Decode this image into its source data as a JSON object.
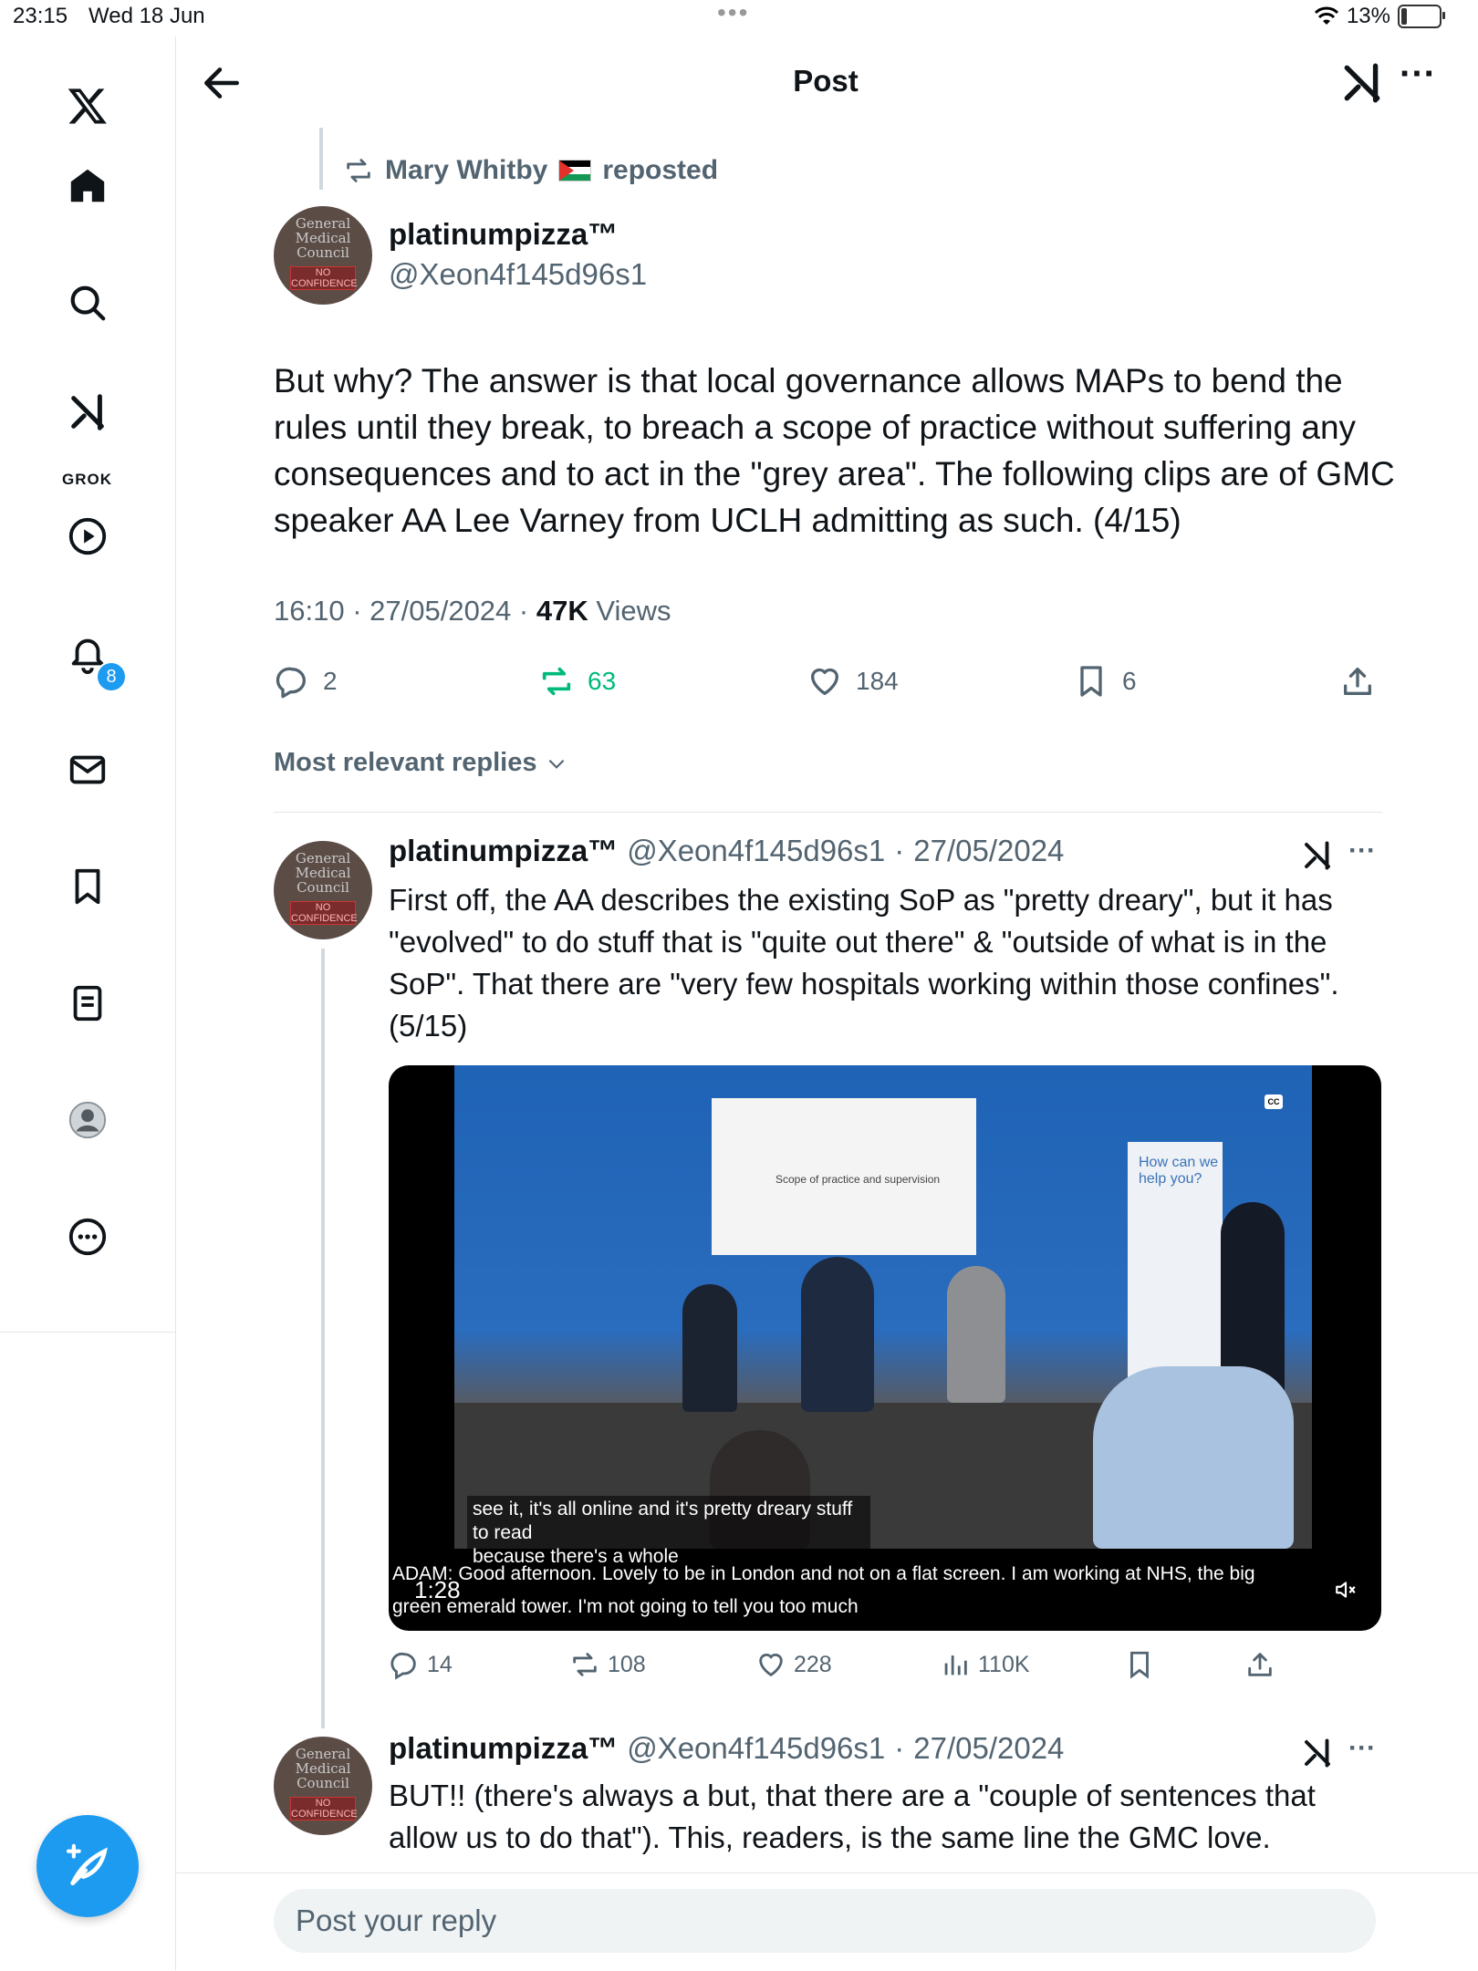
{
  "status_bar": {
    "time": "23:15",
    "date": "Wed 18 Jun",
    "battery": "13%"
  },
  "header": {
    "title": "Post"
  },
  "sidebar": {
    "grok_label": "GROK",
    "notifications_badge": "8"
  },
  "main_post": {
    "repost_label": "Mary Whitby",
    "repost_suffix": "reposted",
    "author_name": "platinumpizza™",
    "author_handle": "@Xeon4f145d96s1",
    "avatar_text": [
      "General",
      "Medical",
      "Council"
    ],
    "avatar_stamp": "NO CONFIDENCE",
    "text": "But why? The answer is that local governance allows MAPs to bend the rules until they break, to breach a scope of practice without suffering any consequences and to act in the \"grey area\". The following clips are of GMC speaker AA Lee Varney from UCLH admitting as such. (4/15)",
    "time": "16:10",
    "date": "27/05/2024",
    "views_count": "47K",
    "views_label": "Views",
    "replies": "2",
    "reposts": "63",
    "likes": "184",
    "bookmarks": "6"
  },
  "sort_label": "Most relevant replies",
  "replies": [
    {
      "author_name": "platinumpizza™",
      "author_handle": "@Xeon4f145d96s1",
      "date": "27/05/2024",
      "text_lines": [
        "First off, the AA describes the existing SoP as \"pretty dreary\", but it has",
        "\"evolved\" to do stuff that is \"quite out there\" & \"outside of what is in the",
        "SoP\". That there are \"very few hospitals working within those confines\".",
        "(5/15)"
      ],
      "video": {
        "slide_text": "Scope of practice and supervision",
        "banner_text": "How can we help you?",
        "caption_line1": "see it, it's all online and it's pretty dreary stuff to read",
        "caption_line2": "because there's a whole",
        "caption2_line1": "ADAM:  Good afternoon.  Lovely to be in London and not on a flat screen.  I am working at NHS, the big",
        "caption2_line2": "green emerald tower.  I'm not going to tell you too much",
        "duration": "1:28",
        "cc": "CC"
      },
      "replies": "14",
      "reposts": "108",
      "likes": "228",
      "views": "110K"
    },
    {
      "author_name": "platinumpizza™",
      "author_handle": "@Xeon4f145d96s1",
      "date": "27/05/2024",
      "text_lines": [
        "BUT!! (there's always a but, that there are a \"couple of sentences that",
        "allow us to do that\"). This, readers, is the same line the GMC love."
      ]
    }
  ],
  "reply_bar": {
    "placeholder": "Post your reply"
  }
}
